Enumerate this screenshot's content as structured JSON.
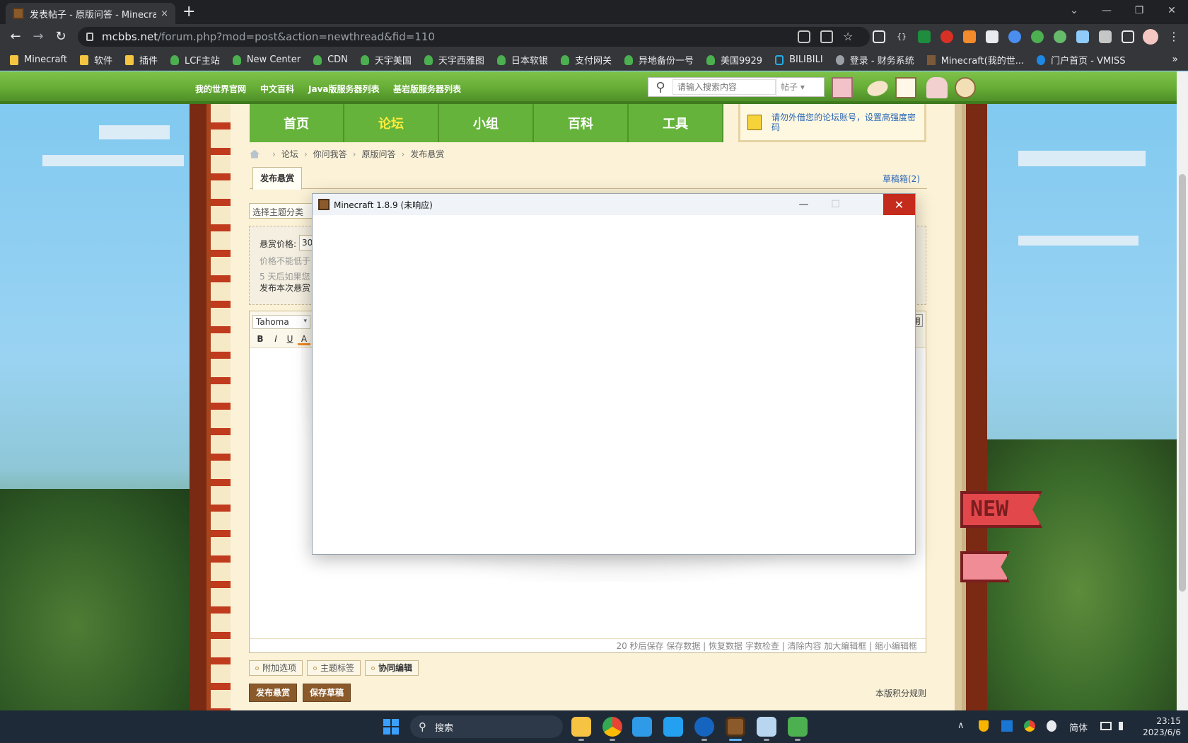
{
  "browser": {
    "tab_title": "发表帖子 - 原版问答 - Minecraft",
    "tab_close": "×",
    "new_tab": "+",
    "url_host": "mcbbs.net",
    "url_path": "/forum.php?mod=post&action=newthread&fid=110",
    "nav": {
      "back": "←",
      "forward": "→",
      "reload": "↻"
    },
    "window_controls": {
      "dropdown": "⌄",
      "minimize": "—",
      "restore": "❐",
      "close": "✕"
    },
    "bookmarks": [
      {
        "label": "Minecraft",
        "icon": "folder-icon"
      },
      {
        "label": "软件",
        "icon": "folder-icon"
      },
      {
        "label": "插件",
        "icon": "folder-icon"
      },
      {
        "label": "LCF主站",
        "icon": "leaf-icon"
      },
      {
        "label": "New Center",
        "icon": "leaf-icon"
      },
      {
        "label": "CDN",
        "icon": "leaf-icon"
      },
      {
        "label": "天宇美国",
        "icon": "leaf-icon"
      },
      {
        "label": "天宇西雅图",
        "icon": "leaf-icon"
      },
      {
        "label": "日本软银",
        "icon": "leaf-icon"
      },
      {
        "label": "支付网关",
        "icon": "leaf-icon"
      },
      {
        "label": "异地备份一号",
        "icon": "leaf-icon"
      },
      {
        "label": "美国9929",
        "icon": "leaf-icon"
      },
      {
        "label": "BILIBILI",
        "icon": "bilibili-icon"
      },
      {
        "label": "登录 - 财务系统",
        "icon": "globe-icon"
      },
      {
        "label": "Minecraft(我的世...",
        "icon": "minecraft-icon"
      },
      {
        "label": "门户首页 - VMISS",
        "icon": "vmiss-icon"
      }
    ],
    "bookmarks_more": "»"
  },
  "site": {
    "top_links": [
      "我的世界官网",
      "中文百科",
      "Java版服务器列表",
      "基岩版服务器列表"
    ],
    "search": {
      "icon": "⚲",
      "placeholder": "请输入搜索内容",
      "scope": "帖子",
      "scope_arrow": "▾"
    },
    "main_nav": [
      {
        "label": "首页",
        "active": false
      },
      {
        "label": "论坛",
        "active": true
      },
      {
        "label": "小组",
        "active": false
      },
      {
        "label": "百科",
        "active": false
      },
      {
        "label": "工具",
        "active": false
      }
    ],
    "notice": "请勿外借您的论坛账号，设置高强度密码",
    "breadcrumb": [
      "论坛",
      "你问我答",
      "原版问答",
      "发布悬赏"
    ],
    "breadcrumb_sep": "›",
    "subtab": "发布悬赏",
    "draft_link": "草稿箱(2)",
    "type_select": "选择主题分类",
    "reward": {
      "price_label": "悬赏价格:",
      "price_value": "30",
      "line1": "价格不能低于",
      "line2": "5 天后如果您",
      "line3": "发布本次悬赏"
    },
    "editor": {
      "font": "Tahoma",
      "font_arrow": "▾",
      "bold": "B",
      "italic": "I",
      "underline": "U",
      "color": "A",
      "right_btn": "用",
      "status": "20 秒后保存 保存数据 | 恢复数据    字数检查 | 清除内容    加大编辑框 | 缩小编辑框"
    },
    "options": [
      "附加选项",
      "主题标签",
      "协同编辑"
    ],
    "buttons": {
      "publish": "发布悬赏",
      "save_draft": "保存草稿"
    },
    "rules_link": "本版积分规则",
    "new_flag": "NEW"
  },
  "dialog": {
    "title": "Minecraft 1.8.9 (未响应)",
    "minimize": "—",
    "maximize": "☐",
    "close": "✕"
  },
  "taskbar": {
    "search_label": "搜索",
    "search_icon": "⚲",
    "tray": {
      "chevron": "∧",
      "ime": "简体"
    },
    "time": "23:15",
    "date": "2023/6/6"
  },
  "colors": {
    "accent_green": "#65b33a",
    "close_red": "#c42b1c",
    "link_blue": "#2a65b5",
    "button_brown": "#8b5a2b"
  }
}
